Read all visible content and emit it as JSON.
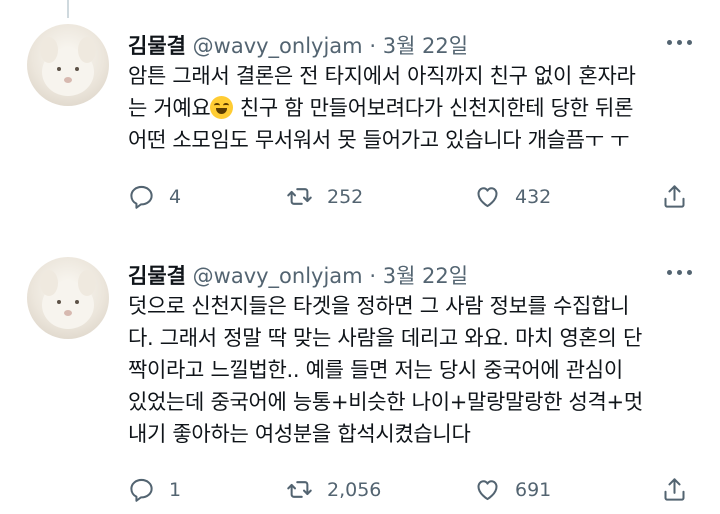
{
  "tweets": [
    {
      "name": "김물결",
      "handle": "@wavy_onlyjam",
      "separator": "·",
      "date": "3월 22일",
      "text_before_emoji": "암튼 그래서 결론은 전 타지에서 아직까지 친구 없이 혼자라\n는 거예요",
      "emoji": "face-with-tears-of-joy",
      "text_after_emoji": " 친구 함 만들어보려다가 신천지한테 당한 뒤론\n어떤 소모임도 무서워서 못 들어가고 있습니다 개슬픔ㅜ ㅜ",
      "replies": "4",
      "retweets": "252",
      "likes": "432"
    },
    {
      "name": "김물결",
      "handle": "@wavy_onlyjam",
      "separator": "·",
      "date": "3월 22일",
      "text": "덧으로 신천지들은 타겟을 정하면 그 사람 정보를 수집합니\n다. 그래서 정말 딱 맞는 사람을 데리고 와요. 마치 영혼의 단\n짝이라고 느낄법한.. 예를 들면 저는 당시 중국어에 관심이\n있었는데 중국어에 능통+비슷한 나이+말랑말랑한 성격+멋\n내기 좋아하는 여성분을 합석시켰습니다",
      "replies": "1",
      "retweets": "2,056",
      "likes": "691"
    }
  ],
  "icons": {
    "reply": "reply-icon",
    "retweet": "retweet-icon",
    "like": "like-icon",
    "share": "share-icon",
    "more": "more-icon"
  }
}
